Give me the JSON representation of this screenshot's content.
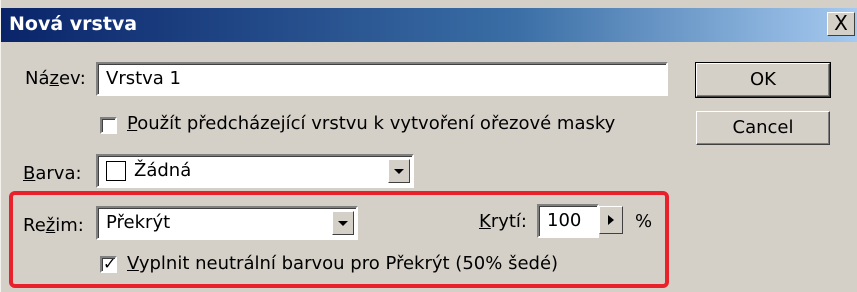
{
  "window": {
    "title": "Nová vrstva",
    "close_glyph": "X"
  },
  "form": {
    "name_label_pre": "Ná",
    "name_label_acc": "z",
    "name_label_post": "ev:",
    "name_value": "Vrstva 1",
    "clip_checkbox_acc": "P",
    "clip_checkbox_label": "oužít předcházející vrstvu k vytvoření ořezové masky",
    "clip_checked": false,
    "color_label_acc": "B",
    "color_label_post": "arva:",
    "color_value": "Žádná",
    "mode_label_pre": "Re",
    "mode_label_acc": "ž",
    "mode_label_post": "im:",
    "mode_value": "Překrýt",
    "opacity_label_acc": "K",
    "opacity_label_post": "rytí:",
    "opacity_value": "100",
    "opacity_unit": "%",
    "fill_checkbox_acc": "V",
    "fill_checkbox_label": "yplnit neutrální barvou pro Překrýt (50% šedé)",
    "fill_checked": true,
    "check_glyph": "✓"
  },
  "buttons": {
    "ok": "OK",
    "cancel": "Cancel"
  },
  "colors": {
    "highlight_border": "#e8212b",
    "dialog_bg": "#d4d0c8",
    "title_bg": "#0a246a"
  }
}
